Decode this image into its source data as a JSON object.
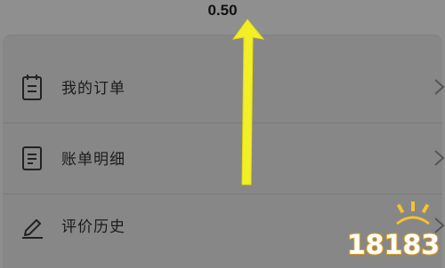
{
  "header": {
    "balance": "0.50"
  },
  "menu": {
    "items": [
      {
        "label": "我的订单",
        "icon": "clipboard-icon"
      },
      {
        "label": "账单明细",
        "icon": "document-icon"
      },
      {
        "label": "评价历史",
        "icon": "pen-icon"
      }
    ]
  },
  "annotation": {
    "arrow_color": "#f3ef26",
    "arrow_direction": "up"
  },
  "watermark": {
    "text": "18183"
  },
  "colors": {
    "overlay_background": "#8e8e8e",
    "card_background": "#878787",
    "text": "#1b1b1b"
  }
}
